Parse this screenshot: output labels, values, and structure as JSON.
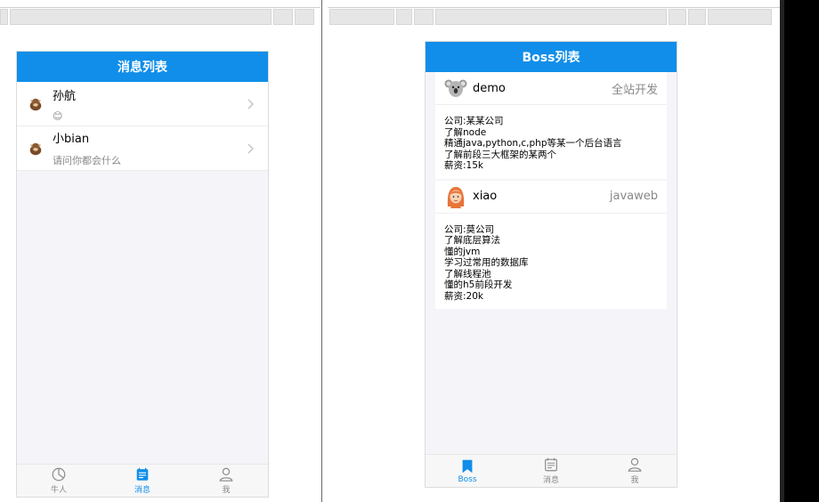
{
  "colors": {
    "primary": "#108ee9",
    "inactive": "#888888"
  },
  "left": {
    "navbar_title": "消息列表",
    "messages": [
      {
        "name": "孙航",
        "preview": "😊",
        "avatar_icon": "cow-icon"
      },
      {
        "name": "小bian",
        "preview": "请问你都会什么",
        "avatar_icon": "cow-icon"
      }
    ],
    "tabs": [
      {
        "label": "牛人",
        "icon": "clock-icon",
        "active": false
      },
      {
        "label": "消息",
        "icon": "calendar-icon",
        "active": true
      },
      {
        "label": "我",
        "icon": "user-icon",
        "active": false
      }
    ]
  },
  "right": {
    "navbar_title": "Boss列表",
    "cards": [
      {
        "name": "demo",
        "position": "全站开发",
        "avatar_icon": "koala-icon",
        "lines": [
          "公司:某某公司",
          "了解node",
          "精通java,python,c,php等某一个后台语言",
          "了解前段三大框架的某两个",
          "薪资:15k"
        ]
      },
      {
        "name": "xiao",
        "position": "javaweb",
        "avatar_icon": "girl-icon",
        "lines": [
          "公司:莫公司",
          "了解底层算法",
          "懂的jvm",
          "学习过常用的数据库",
          "了解线程池",
          "懂的h5前段开发",
          "薪资:20k"
        ]
      }
    ],
    "tabs": [
      {
        "label": "Boss",
        "icon": "bookmark-icon",
        "active": true
      },
      {
        "label": "消息",
        "icon": "calendar-icon",
        "active": false
      },
      {
        "label": "我",
        "icon": "user-icon",
        "active": false
      }
    ]
  }
}
